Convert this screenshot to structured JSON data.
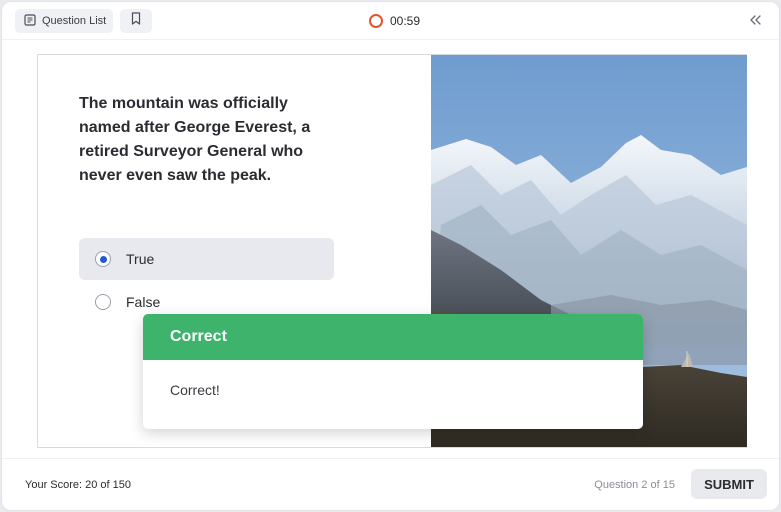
{
  "header": {
    "question_list_label": "Question List",
    "timer": "00:59",
    "accent_color": "#e2542c"
  },
  "question": {
    "text": "The mountain was officially named after George Everest, a retired Surveyor General who never even saw the peak.",
    "options": [
      {
        "label": "True",
        "selected": true
      },
      {
        "label": "False",
        "selected": false
      }
    ],
    "image_icon": "mountain-photo"
  },
  "feedback": {
    "title": "Correct",
    "message": "Correct!",
    "color": "#3db36b"
  },
  "footer": {
    "score": "Your Score: 20 of 150",
    "progress": "Question 2 of 15",
    "submit_label": "SUBMIT"
  }
}
